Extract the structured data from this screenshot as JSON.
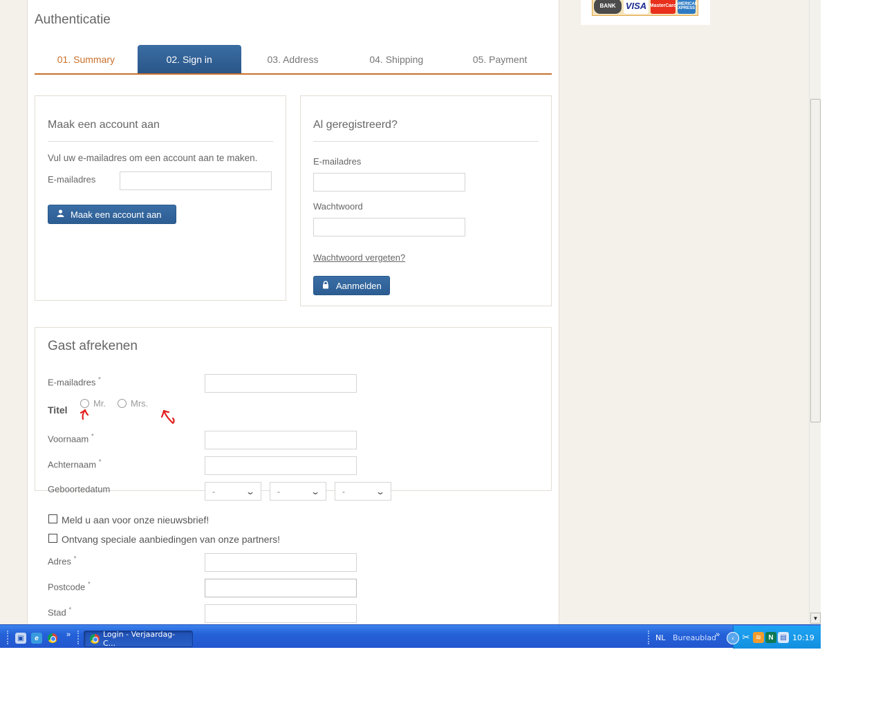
{
  "page": {
    "heading": "Authenticatie"
  },
  "steps": [
    {
      "label": "01. Summary",
      "state": "done"
    },
    {
      "label": "02. Sign in",
      "state": "active"
    },
    {
      "label": "03. Address",
      "state": "todo"
    },
    {
      "label": "04. Shipping",
      "state": "todo"
    },
    {
      "label": "05. Payment",
      "state": "todo"
    }
  ],
  "payment_logos": {
    "bank": "BANK",
    "visa": "VISA",
    "mastercard": "MasterCard",
    "amex": "AMERICAN EXPRESS"
  },
  "create_account": {
    "title": "Maak een account aan",
    "instruction": "Vul uw e-mailadres om een account aan te maken.",
    "email_label": "E-mailadres",
    "email_value": "",
    "button_label": "Maak een account aan",
    "button_icon": "user-icon"
  },
  "login": {
    "title": "Al geregistreerd?",
    "email_label": "E-mailadres",
    "email_value": "",
    "password_label": "Wachtwoord",
    "password_value": "",
    "forgot_link": "Wachtwoord vergeten?",
    "button_label": "Aanmelden",
    "button_icon": "lock-icon"
  },
  "guest": {
    "title": "Gast afrekenen",
    "required_mark": "*",
    "email_label": "E-mailadres",
    "title_label": "Titel",
    "title_options": [
      "Mr.",
      "Mrs."
    ],
    "firstname_label": "Voornaam",
    "lastname_label": "Achternaam",
    "birthdate_label": "Geboortedatum",
    "birthdate_day": "-",
    "birthdate_month": "-",
    "birthdate_year": "-",
    "newsletter_label": "Meld u aan voor onze nieuwsbrief!",
    "partners_label": "Ontvang speciale aanbiedingen van onze partners!",
    "address_label": "Adres",
    "postcode_label": "Postcode",
    "city_label": "Stad"
  },
  "annotation_color": "#e21d1d",
  "taskbar": {
    "window_title": "Login - Verjaardag-C...",
    "language": "NL",
    "desktop_label": "Bureaublad",
    "clock": "10:19",
    "chevron": "»"
  }
}
